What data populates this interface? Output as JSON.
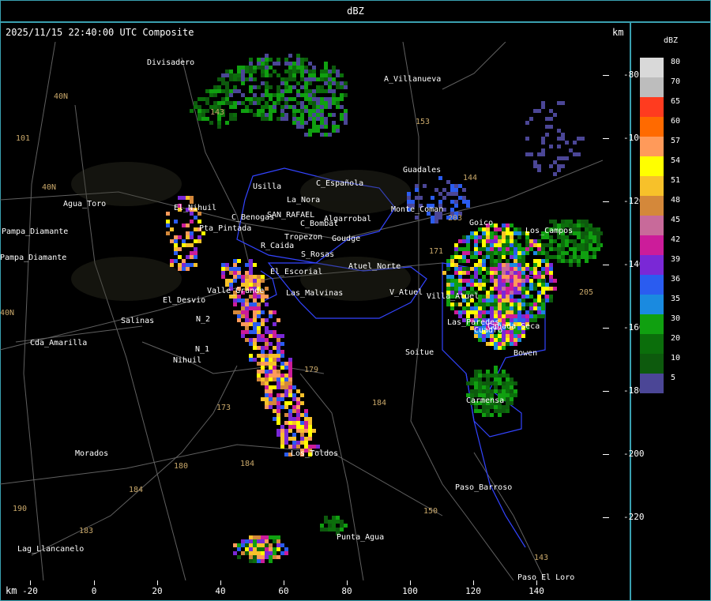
{
  "header": {
    "title": "dBZ"
  },
  "plot": {
    "timestamp": "2025/11/15 22:40:00 UTC Composite",
    "km_top": "km",
    "km_bottom": "km",
    "y_ticks": [
      "-80",
      "-100",
      "-120",
      "-140",
      "-160",
      "-180",
      "-200",
      "-220"
    ],
    "x_ticks": [
      "-20",
      "0",
      "20",
      "40",
      "60",
      "80",
      "100",
      "120",
      "140"
    ]
  },
  "legend": {
    "title": "dBZ",
    "colors": [
      "#d9d9d9",
      "#bdbdbd",
      "#ff3b1f",
      "#ff6a00",
      "#ff9a5a",
      "#ffff00",
      "#f7c12a",
      "#d4883a",
      "#c86a9a",
      "#cc1c9a",
      "#7a28d6",
      "#2a5cf0",
      "#1a8ae0",
      "#10a010",
      "#0b6e0b",
      "#0d5a0d",
      "#4b4696"
    ],
    "labels": [
      "80",
      "70",
      "65",
      "60",
      "57",
      "54",
      "51",
      "48",
      "45",
      "42",
      "39",
      "36",
      "35",
      "30",
      "20",
      "10",
      "5"
    ]
  },
  "places": [
    "Divisadero",
    "A_Villanueva",
    "Agua_Toro",
    "Pampa_Diamante",
    "El_Desvio",
    "Salinas",
    "Cda_Amarilla",
    "Nihuil",
    "Morados",
    "Lag_Llancanelo",
    "Los_Toldos",
    "Punta_Agua",
    "Paso_Barroso",
    "Paso_El_Loro",
    "Soitue",
    "V_Atuel",
    "Carmensa",
    "Bowen",
    "Goico",
    "Usilla",
    "C_Española",
    "La_Nora",
    "C_Benogas",
    "SAN_RAFAEL",
    "Algarrobal",
    "R_Caida",
    "S_Rosas",
    "El_Escorial",
    "Las_Malvinas",
    "Valle_Grande",
    "Atuel_Norte",
    "Cuadro",
    "Cañada Seca",
    "Pampa_Diamante",
    "N_2",
    "N_1",
    "Las_Paredes",
    "Guadales",
    "C_Bombal",
    "Tropezon",
    "Goudge",
    "Monte_Coman",
    "Villa_Atuel",
    "Pta_Pintada",
    "Los_Campos",
    "El_Nihuil"
  ],
  "road_labels": [
    "101",
    "40N",
    "40N",
    "143",
    "153",
    "150",
    "144",
    "173",
    "179",
    "184",
    "180",
    "184",
    "183",
    "190",
    "143",
    "184",
    "203",
    "171",
    "205",
    "40N"
  ]
}
